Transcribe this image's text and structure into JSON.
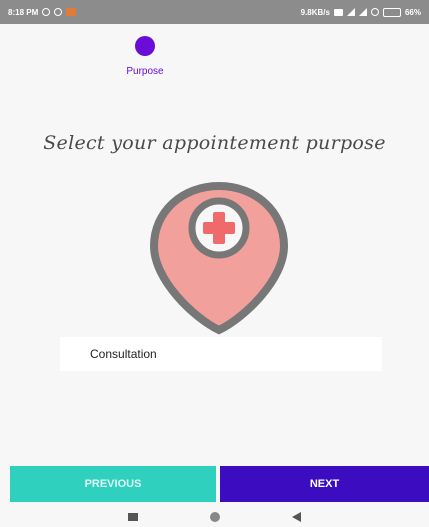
{
  "status_bar": {
    "time": "8:18 PM",
    "network_speed": "9.8KB/s",
    "battery": "66%"
  },
  "stepper": {
    "step_label": "Purpose",
    "active_color": "#6a0dd6"
  },
  "heading": "Select your appointement purpose",
  "purpose_field": {
    "value": "Consultation"
  },
  "icons": {
    "illustration": "medical-location-pin-icon"
  },
  "buttons": {
    "previous_label": "PREVIOUS",
    "next_label": "NEXT",
    "previous_color": "#2fd1be",
    "next_color": "#3b0cc0"
  },
  "nav_bar": {
    "icons": [
      "recents-icon",
      "home-icon",
      "back-icon"
    ]
  }
}
